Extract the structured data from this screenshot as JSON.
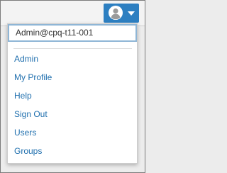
{
  "user_menu": {
    "current_user": "Admin@cpq-t11-001",
    "items": [
      {
        "label": "Admin"
      },
      {
        "label": "My Profile"
      },
      {
        "label": "Help"
      },
      {
        "label": "Sign Out"
      },
      {
        "label": "Users"
      },
      {
        "label": "Groups"
      }
    ]
  },
  "colors": {
    "accent": "#2d7fc1",
    "link": "#1f6fae",
    "focus_border": "#8fb6d6"
  },
  "icons": {
    "user_button": "user-avatar-icon",
    "dropdown": "caret-down-icon"
  }
}
